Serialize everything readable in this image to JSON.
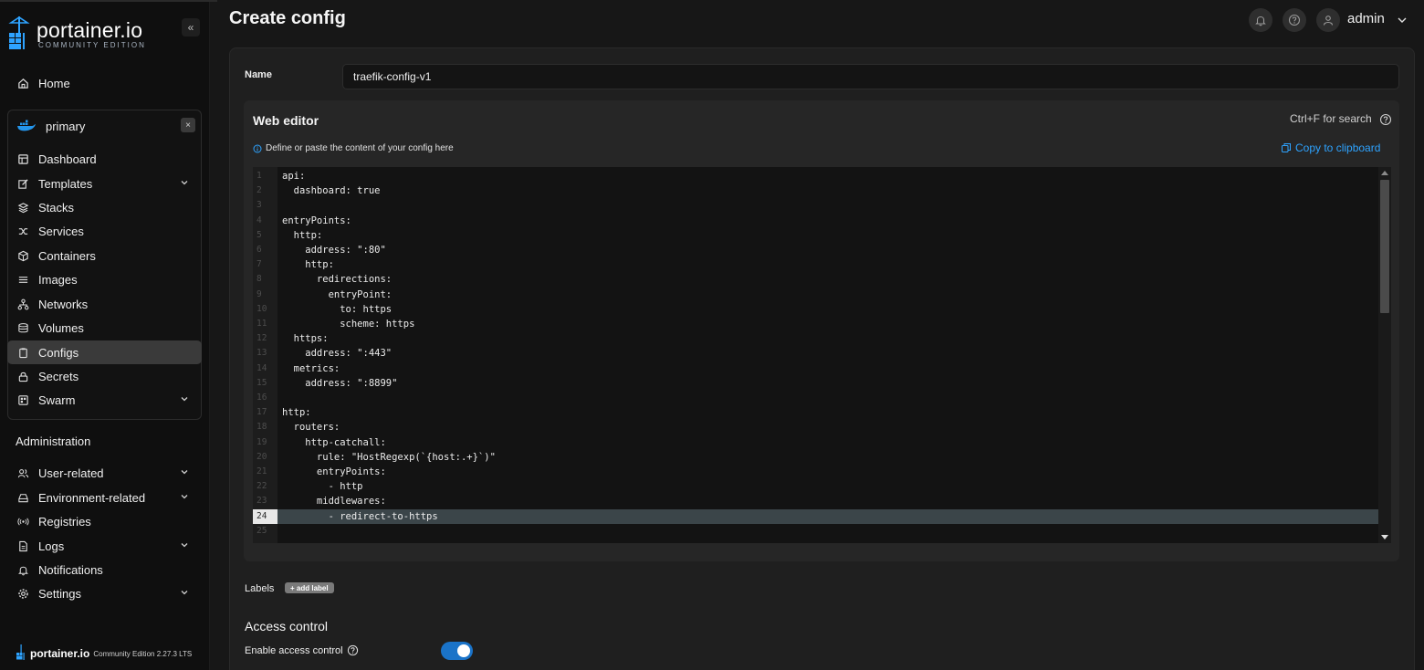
{
  "brand": {
    "name": "portainer.io",
    "edition": "COMMUNITY EDITION"
  },
  "sidebar": {
    "collapse_icon": "«",
    "home": "Home",
    "environment": {
      "name": "primary",
      "close": "×"
    },
    "env_items": [
      {
        "label": "Dashboard",
        "icon": "dashboard-icon"
      },
      {
        "label": "Templates",
        "icon": "edit-icon",
        "expandable": true
      },
      {
        "label": "Stacks",
        "icon": "layers-icon"
      },
      {
        "label": "Services",
        "icon": "shuffle-icon"
      },
      {
        "label": "Containers",
        "icon": "box-icon"
      },
      {
        "label": "Images",
        "icon": "list-icon"
      },
      {
        "label": "Networks",
        "icon": "network-icon"
      },
      {
        "label": "Volumes",
        "icon": "database-icon"
      },
      {
        "label": "Configs",
        "icon": "clipboard-icon",
        "active": true
      },
      {
        "label": "Secrets",
        "icon": "lock-icon"
      },
      {
        "label": "Swarm",
        "icon": "swarm-icon",
        "expandable": true
      }
    ],
    "admin_title": "Administration",
    "admin_items": [
      {
        "label": "User-related",
        "icon": "users-icon",
        "expandable": true
      },
      {
        "label": "Environment-related",
        "icon": "drive-icon",
        "expandable": true
      },
      {
        "label": "Registries",
        "icon": "radio-icon"
      },
      {
        "label": "Logs",
        "icon": "file-icon",
        "expandable": true
      },
      {
        "label": "Notifications",
        "icon": "bell-icon"
      },
      {
        "label": "Settings",
        "icon": "gear-icon",
        "expandable": true
      }
    ],
    "footer": {
      "name": "portainer.io",
      "version": "Community Edition 2.27.3 LTS"
    }
  },
  "header": {
    "title": "Create config",
    "user": "admin"
  },
  "form": {
    "name_label": "Name",
    "name_value": "traefik-config-v1",
    "editor_title": "Web editor",
    "search_hint": "Ctrl+F for search",
    "editor_hint": "Define or paste the content of your config here",
    "copy_label": "Copy to clipboard",
    "highlighted_line": 24,
    "code_lines": [
      "api:",
      "  dashboard: true",
      "",
      "entryPoints:",
      "  http:",
      "    address: \":80\"",
      "    http:",
      "      redirections:",
      "        entryPoint:",
      "          to: https",
      "          scheme: https",
      "  https:",
      "    address: \":443\"",
      "  metrics:",
      "    address: \":8899\"",
      "",
      "http:",
      "  routers:",
      "    http-catchall:",
      "      rule: \"HostRegexp(`{host:.+}`)\"",
      "      entryPoints:",
      "        - http",
      "      middlewares:",
      "        - redirect-to-https",
      ""
    ],
    "labels_label": "Labels",
    "add_label": "+ add label",
    "access_title": "Access control",
    "access_label": "Enable access control",
    "access_enabled": true
  },
  "colors": {
    "accent": "#2ea3ff",
    "toggle_on": "#1a73c8",
    "active_nav": "#3a3a3a",
    "docker_blue": "#2496ed"
  }
}
